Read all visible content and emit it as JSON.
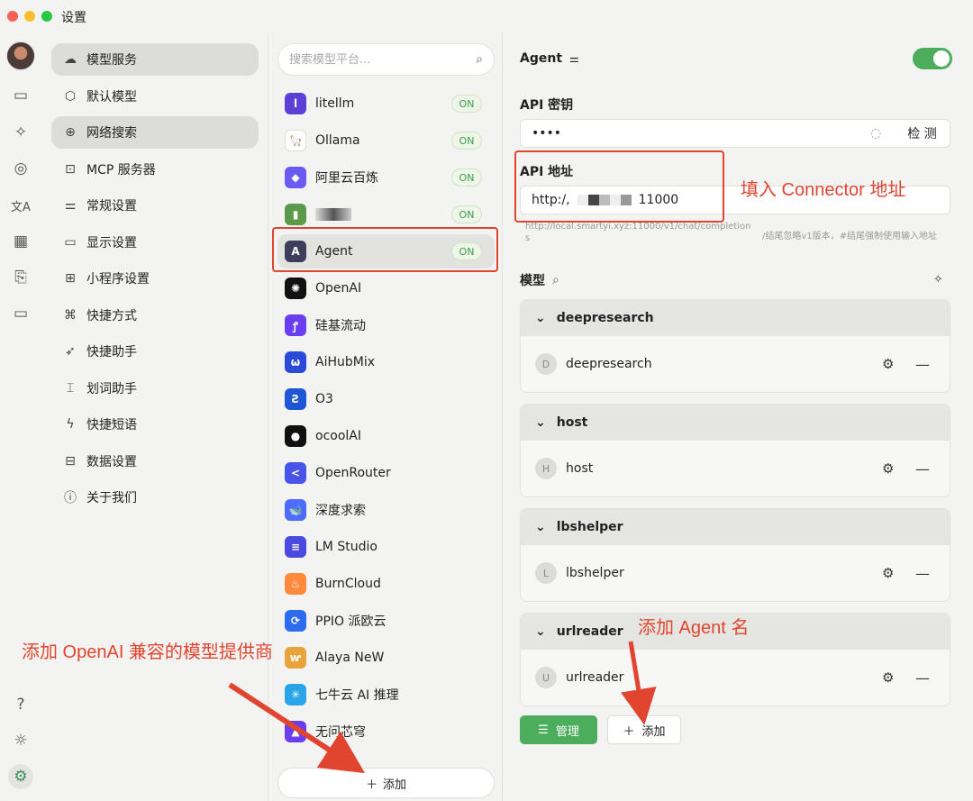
{
  "window": {
    "title": "设置"
  },
  "rail": {
    "icons": [
      "chat-icon",
      "sparkle-icon",
      "palette-icon",
      "translate-icon",
      "grid-icon",
      "doc-icon",
      "folder-icon",
      "help-icon",
      "sun-icon",
      "settings-icon"
    ]
  },
  "menu": {
    "items": [
      {
        "label": "模型服务",
        "icon": "cloud-icon",
        "selected": true
      },
      {
        "label": "默认模型",
        "icon": "cube-icon"
      },
      {
        "label": "网络搜索",
        "icon": "globe-icon",
        "selected": true
      },
      {
        "label": "MCP 服务器",
        "icon": "terminal-icon"
      },
      {
        "label": "常规设置",
        "icon": "sliders-icon"
      },
      {
        "label": "显示设置",
        "icon": "monitor-icon"
      },
      {
        "label": "小程序设置",
        "icon": "apps-icon"
      },
      {
        "label": "快捷方式",
        "icon": "command-icon"
      },
      {
        "label": "快捷助手",
        "icon": "rocket-icon"
      },
      {
        "label": "划词助手",
        "icon": "cursor-text-icon"
      },
      {
        "label": "快捷短语",
        "icon": "zap-icon"
      },
      {
        "label": "数据设置",
        "icon": "hard-drive-icon"
      },
      {
        "label": "关于我们",
        "icon": "info-icon"
      }
    ]
  },
  "providers": {
    "search_placeholder": "搜索模型平台...",
    "on_label": "ON",
    "items": [
      {
        "name": "litellm",
        "on": true,
        "color": "#5b3fd6",
        "glyph": "l"
      },
      {
        "name": "Ollama",
        "on": true,
        "color": "#ffffff",
        "glyph": "🦙"
      },
      {
        "name": "阿里云百炼",
        "on": true,
        "color": "#6a5cf0",
        "glyph": "◆"
      },
      {
        "name": "",
        "on": true,
        "color": "#5a9a4a",
        "glyph": "▮"
      },
      {
        "name": "Agent",
        "on": true,
        "color": "#3d3d5c",
        "glyph": "A",
        "selected": true
      },
      {
        "name": "OpenAI",
        "on": false,
        "color": "#111111",
        "glyph": "✺"
      },
      {
        "name": "硅基流动",
        "on": false,
        "color": "#6a3ef0",
        "glyph": "ꝭ"
      },
      {
        "name": "AiHubMix",
        "on": false,
        "color": "#2b4ad8",
        "glyph": "ω"
      },
      {
        "name": "O3",
        "on": false,
        "color": "#1f56d6",
        "glyph": "Ƨ"
      },
      {
        "name": "ocoolAI",
        "on": false,
        "color": "#111111",
        "glyph": "●"
      },
      {
        "name": "OpenRouter",
        "on": false,
        "color": "#4a54e8",
        "glyph": "<"
      },
      {
        "name": "深度求索",
        "on": false,
        "color": "#4d6bfe",
        "glyph": "🐋"
      },
      {
        "name": "LM Studio",
        "on": false,
        "color": "#4a4ae0",
        "glyph": "≡"
      },
      {
        "name": "BurnCloud",
        "on": false,
        "color": "#ff8a3d",
        "glyph": "♨"
      },
      {
        "name": "PPIO 派欧云",
        "on": false,
        "color": "#2d6cf0",
        "glyph": "⟳"
      },
      {
        "name": "Alaya NeW",
        "on": false,
        "color": "#e8a33a",
        "glyph": "ⱳ"
      },
      {
        "name": "七牛云 AI 推理",
        "on": false,
        "color": "#2aa5e8",
        "glyph": "✳"
      },
      {
        "name": "无问芯穹",
        "on": false,
        "color": "#6a3ef0",
        "glyph": "▲"
      }
    ],
    "add_label": "添加"
  },
  "detail": {
    "title": "Agent",
    "enabled": true,
    "api_key_label": "API 密钥",
    "api_key_value": "••••",
    "check_label": "检 测",
    "api_url_label": "API 地址",
    "api_url_value": "http:/,",
    "api_url_tail": "11000",
    "hint_left": "http://local.smartyi.xyz:11000/v1/chat/completion",
    "hint_left2": "s",
    "hint_right": "/结尾忽略v1版本，#结尾强制使用输入地址",
    "models_label": "模型",
    "groups": [
      {
        "name": "deepresearch",
        "model": "deepresearch",
        "initial": "D"
      },
      {
        "name": "host",
        "model": "host",
        "initial": "H"
      },
      {
        "name": "lbshelper",
        "model": "lbshelper",
        "initial": "L"
      },
      {
        "name": "urlreader",
        "model": "urlreader",
        "initial": "U"
      }
    ],
    "manage_label": "管理",
    "add_label": "添加"
  },
  "annotations": {
    "connector": "填入 Connector 地址",
    "provider": "添加 OpenAI 兼容的模型提供商",
    "agent_name": "添加 Agent 名",
    "color": "#e2452f"
  }
}
